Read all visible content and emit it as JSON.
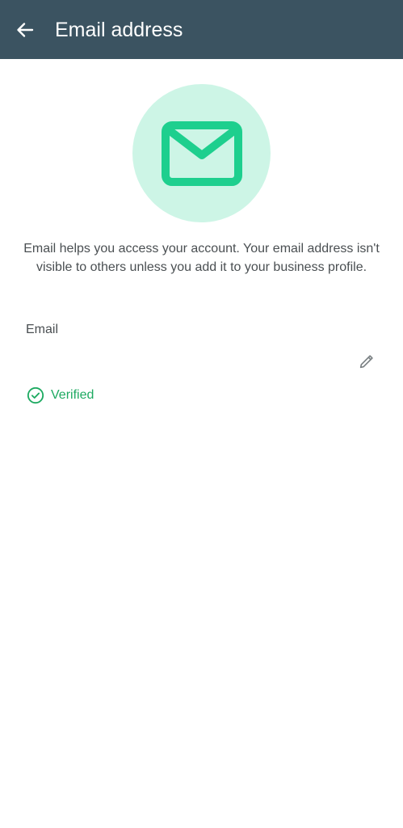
{
  "header": {
    "title": "Email address",
    "back_icon": "arrow-left-icon"
  },
  "hero": {
    "icon": "envelope-icon"
  },
  "description": "Email helps you access your account. Your email address isn't visible to others unless you add it to your business profile.",
  "email_field": {
    "label": "Email",
    "value": "",
    "edit_icon": "pencil-icon"
  },
  "status": {
    "text": "Verified",
    "icon": "check-circle-icon"
  },
  "colors": {
    "app_bar": "#3b5361",
    "accent": "#1daa61",
    "envelope": "#1ecf8e",
    "hero_background": "#cdf5e6",
    "body_text": "#4a4f52",
    "icon_gray": "#7b8184"
  }
}
